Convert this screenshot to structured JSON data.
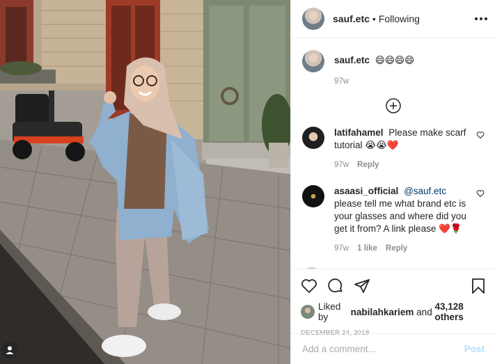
{
  "post": {
    "username": "sauf.etc",
    "follow_separator": "•",
    "follow_status": "Following"
  },
  "caption": {
    "username": "sauf.etc",
    "text": "😄😄😄😄",
    "time": "97w"
  },
  "comments": [
    {
      "username": "latifahamel",
      "text": "Please make scarf tutorial 😭😭❤️",
      "time": "97w",
      "reply": "Reply"
    },
    {
      "username": "asaasi_official",
      "mention": "@sauf.etc",
      "text": "please tell me what brand etc is your glasses and where did you get it from? A link please ❤️🌹",
      "time": "97w",
      "likes": "1 like",
      "reply": "Reply"
    }
  ],
  "likes": {
    "prefix": "Liked by",
    "user": "nabilahkariem",
    "middle": "and",
    "count": "43,128 others"
  },
  "date": "DECEMBER 24, 2018",
  "comment_input": {
    "placeholder": "Add a comment...",
    "post_label": "Post"
  },
  "icons": {
    "more": "more-horizontal-icon",
    "load_more": "plus-circle-icon",
    "like": "heart-icon",
    "comment": "comment-bubble-icon",
    "share": "paper-plane-icon",
    "save": "bookmark-icon",
    "tag": "user-tag-icon"
  },
  "colors": {
    "text": "#262626",
    "muted": "#8e8e8e",
    "mention": "#00376b",
    "post_disabled": "#b2dffc",
    "border": "#efefef"
  }
}
